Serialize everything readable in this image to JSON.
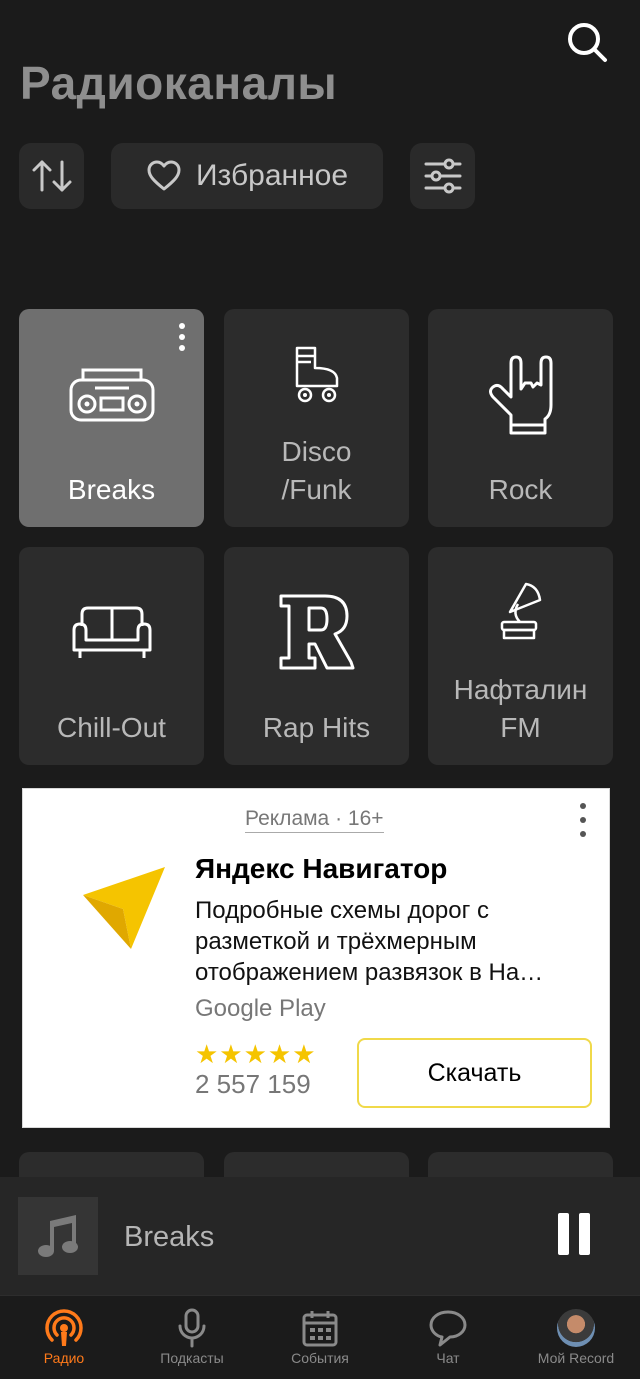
{
  "header": {
    "title": "Радиоканалы"
  },
  "toolbar": {
    "favorites_label": "Избранное"
  },
  "stations": [
    {
      "label": "Breaks",
      "icon": "boombox-icon",
      "active": true
    },
    {
      "label": "Disco\n/Funk",
      "icon": "roller-skate-icon",
      "active": false
    },
    {
      "label": "Rock",
      "icon": "rock-hand-icon",
      "active": false
    },
    {
      "label": "Chill-Out",
      "icon": "sofa-icon",
      "active": false
    },
    {
      "label": "Rap Hits",
      "icon": "letter-r-icon",
      "active": false
    },
    {
      "label": "Нафталин\nFM",
      "icon": "gramophone-icon",
      "active": false
    }
  ],
  "ad": {
    "tag": "Реклама · 16+",
    "title": "Яндекс Навигатор",
    "description": "Подробные схемы дорог с разметкой и трёхмерным отображением развязок в На…",
    "source": "Google Play",
    "stars": "★★★★★",
    "rating": 5,
    "reviews_count": "2 557 159",
    "button_label": "Скачать"
  },
  "player": {
    "track": "Breaks",
    "state": "playing"
  },
  "nav": {
    "items": [
      {
        "label": "Радио",
        "icon": "radio-icon",
        "active": true
      },
      {
        "label": "Подкасты",
        "icon": "microphone-icon",
        "active": false
      },
      {
        "label": "События",
        "icon": "calendar-icon",
        "active": false
      },
      {
        "label": "Чат",
        "icon": "chat-icon",
        "active": false
      },
      {
        "label": "Мой Record",
        "icon": "avatar",
        "active": false
      }
    ]
  },
  "colors": {
    "background": "#1b1b1b",
    "tile": "#2c2c2c",
    "tile_active": "#6f6f6f",
    "accent": "#ff7a1a",
    "star": "#f5c400"
  }
}
